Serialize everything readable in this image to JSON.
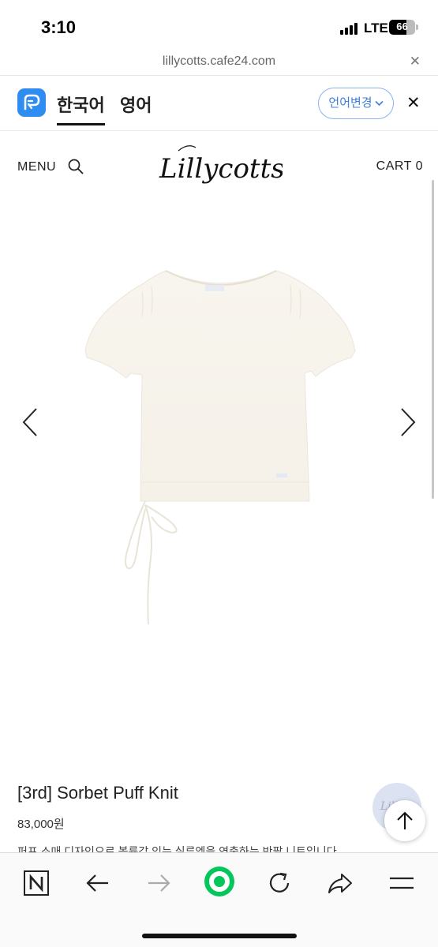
{
  "status_bar": {
    "time": "3:10",
    "network": "LTE",
    "battery": "66"
  },
  "browser": {
    "url": "lillycotts.cafe24.com"
  },
  "translate_bar": {
    "active_language": "한국어",
    "other_language": "영어",
    "change_label": "언어변경"
  },
  "header": {
    "menu_label": "MENU",
    "logo_text": "Lillycotts",
    "cart_label": "CART 0"
  },
  "product": {
    "name": "[3rd] Sorbet Puff Knit",
    "price": "83,000원",
    "description": "퍼프 소매 디자인으로 볼륨감 있는 실루엣을 연출하는 반팔 니트입니다"
  },
  "floating": {
    "badge_text": "Lilly"
  },
  "toolbar": {
    "icons": [
      "naver-n-icon",
      "back-arrow-icon",
      "forward-arrow-icon",
      "green-circle-icon",
      "refresh-icon",
      "share-icon",
      "hamburger-menu-icon"
    ]
  },
  "colors": {
    "accent_blue": "#2f8cf0",
    "naver_green": "#03c75a",
    "text": "#222222"
  }
}
